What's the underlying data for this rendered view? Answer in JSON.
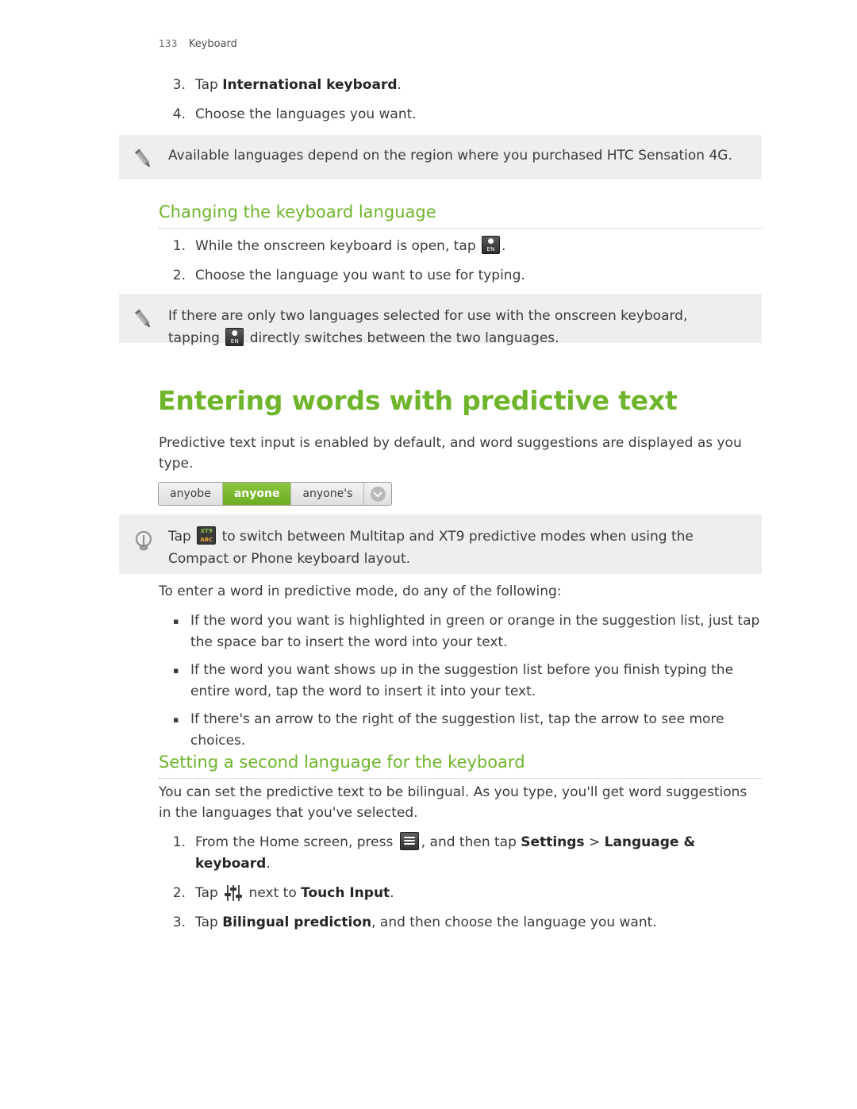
{
  "header": {
    "page_number": "133",
    "chapter": "Keyboard"
  },
  "top_steps": [
    {
      "marker": "3.",
      "pre": "Tap ",
      "bold": "International keyboard",
      "post": "."
    },
    {
      "marker": "4.",
      "pre": "Choose the languages you want.",
      "bold": "",
      "post": ""
    }
  ],
  "note_1": {
    "icon": "pencil-icon",
    "text": "Available languages depend on the region where you purchased HTC Sensation 4G."
  },
  "section_changing": {
    "heading": "Changing the keyboard language",
    "steps": [
      {
        "marker": "1.",
        "text_before": "While the onscreen keyboard is open, tap ",
        "icon": "language-key-icon",
        "text_after": "."
      },
      {
        "marker": "2.",
        "text_before": "Choose the language you want to use for typing.",
        "icon": "",
        "text_after": ""
      }
    ]
  },
  "note_2": {
    "icon": "pencil-icon",
    "line1": "If there are only two languages selected for use with the onscreen keyboard,",
    "line2_before": "tapping ",
    "line2_icon": "language-key-icon",
    "line2_after": " directly switches between the two languages."
  },
  "main_heading": "Entering words with predictive text",
  "intro_paragraph": "Predictive text input is enabled by default, and word suggestions are displayed as you type.",
  "suggestion_strip": {
    "items": [
      {
        "label": "anyobe",
        "active": false
      },
      {
        "label": "anyone",
        "active": true
      },
      {
        "label": "anyone's",
        "active": false
      }
    ],
    "arrow_icon": "chevron-down-icon"
  },
  "note_3": {
    "icon": "lightbulb-icon",
    "text_before": "Tap ",
    "icon_inline": "xt9-key-icon",
    "text_after": " to switch between Multitap and XT9 predictive modes when using the Compact or Phone keyboard layout."
  },
  "predictive_lead": "To enter a word in predictive mode, do any of the following:",
  "bullets": [
    "If the word you want is highlighted in green or orange in the suggestion list, just tap the space bar to insert the word into your text.",
    "If the word you want shows up in the suggestion list before you finish typing the entire word, tap the word to insert it into your text.",
    "If there's an arrow to the right of the suggestion list, tap the arrow to see more choices."
  ],
  "section_second_language": {
    "heading": "Setting a second language for the keyboard",
    "paragraph": "You can set the predictive text to be bilingual. As you type, you'll get word suggestions in the languages that you've selected.",
    "steps": [
      {
        "marker": "1.",
        "seg1": "From the Home screen, press ",
        "icon": "menu-key-icon",
        "seg2": ", and then tap ",
        "bold1": "Settings",
        "seg3": " > ",
        "bold2": "Language & keyboard",
        "seg4": "."
      },
      {
        "marker": "2.",
        "seg1": "Tap ",
        "icon": "sliders-icon",
        "seg2": " next to ",
        "bold1": "Touch Input",
        "seg3": ".",
        "bold2": "",
        "seg4": ""
      },
      {
        "marker": "3.",
        "seg1": "Tap ",
        "icon": "",
        "seg2": "",
        "bold1": "Bilingual prediction",
        "seg3": ", and then choose the language you want.",
        "bold2": "",
        "seg4": ""
      }
    ]
  },
  "colors": {
    "accent_green": "#6eb52b",
    "note_bg": "#eeeeee",
    "body_text": "#3b3b3b"
  }
}
